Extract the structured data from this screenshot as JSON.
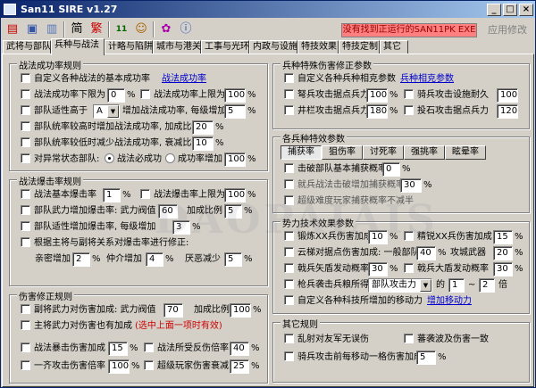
{
  "window": {
    "title": "San11 SIRE v1.27",
    "title_icon": "SIRE"
  },
  "toolbar": {
    "jian": "简",
    "fan": "繁",
    "number": "11"
  },
  "status": "没有找到正运行的SAN11PK EXE",
  "apply": "应用修改",
  "tabs": [
    "武将与部队",
    "兵种与战法",
    "计略与陷阱",
    "城市与港关",
    "工事与光环",
    "内政与设施",
    "特技效果",
    "特技定制",
    "其它"
  ],
  "g1": {
    "title": "战法成功率规则",
    "r1": "自定义各种战法的基本成功率",
    "r1link": "战法成功率",
    "r2a": "战法成功率下限为",
    "r2av": "0",
    "r2au": "%",
    "r2b": "战法成功率上限为",
    "r2bv": "100",
    "r2bu": "%",
    "r3a": "部队适性高于",
    "r3sel": "A",
    "r3b": "增加战法成功率, 每级增加",
    "r3v": "5",
    "r3u": "%",
    "r4": "部队统率较高时增加战法成功率, 加成比例",
    "r4v": "20",
    "r4u": "%",
    "r5": "部队统率较低时减少战法成功率, 衰减比例",
    "r5v": "10",
    "r5u": "%",
    "r6": "对异常状态部队:",
    "r6r1": "战法必成功",
    "r6r2": "成功率增加",
    "r6v": "100",
    "r6u": "%"
  },
  "g2": {
    "title": "战法爆击率规则",
    "r1a": "战法基本爆击率",
    "r1av": "1",
    "r1au": "%",
    "r1b": "战法爆击率上限为",
    "r1bv": "100",
    "r1bu": "%",
    "r2": "部队武力增加爆击率: 武力阀值",
    "r2v1": "60",
    "r2b": "加成比例",
    "r2v2": "5",
    "r2u": "%",
    "r3": "部队适性增加爆击率, 每级增加",
    "r3v": "3",
    "r3u": "%",
    "r4": "根据主将与副将关系对爆击率进行修正:",
    "r5a": "亲密增加",
    "r5av": "2",
    "r5b": "仲介增加",
    "r5bv": "4",
    "r5c": "厌恶减少",
    "r5cv": "5",
    "r5u": "%"
  },
  "g3": {
    "title": "伤害修正规则",
    "r1": "副将武力对伤害加成: 武力阀值",
    "r1v1": "70",
    "r1b": "加成比例",
    "r1v2": "100",
    "r1u": "%",
    "r2": "主将武力对伤害也有加成",
    "r2note": "(选中上面一项时有效)",
    "r3a": "战法暴击伤害加成",
    "r3av": "15",
    "r3u": "%",
    "r3b": "战法所受反伤倍率",
    "r3bv": "40",
    "r4a": "一齐攻击伤害倍率",
    "r4av": "100",
    "r4b": "超级玩家伤害衰减",
    "r4bv": "25"
  },
  "g4": {
    "title": "兵种特殊伤害修正参数",
    "r1": "自定义各种兵种相克参数",
    "r1link": "兵种相克参数",
    "r2a": "弩兵攻击据点兵力",
    "r2av": "100",
    "r2b": "骑兵攻击设施耐久",
    "r2bv": "100",
    "r3a": "井栏攻击据点兵力",
    "r3av": "180",
    "r3b": "投石攻击据点兵力",
    "r3bv": "120",
    "u": "%"
  },
  "g5": {
    "title": "各兵种特效参数",
    "subtabs": [
      "捕获率",
      "狙伤率",
      "讨死率",
      "强挑率",
      "眩晕率"
    ],
    "r1": "击破部队基本捕获概率",
    "r1v": "0",
    "r1u": "%",
    "r2": "就兵战法击破增加捕获概率",
    "r2v": "30",
    "r2u": "%",
    "r3": "超级难度玩家捕获概率不减半"
  },
  "g6": {
    "title": "势力技术效果参数",
    "r1a": "锻炼XX兵伤害加成",
    "r1av": "10",
    "r1b": "精锐XX兵伤害加成",
    "r1bv": "15",
    "r2a": "云梯对据点伤害加成: 一般部队",
    "r2av": "40",
    "r2b": "攻城武器",
    "r2bv": "20",
    "r3a": "戟兵矢盾发动概率",
    "r3av": "30",
    "r3b": "戟兵大盾发动概率",
    "r3bv": "30",
    "r4": "枪兵袭击兵粮所得",
    "r4sel": "部队攻击力",
    "r4of": "的",
    "r4v1": "1",
    "r4t": "~",
    "r4v2": "2",
    "r4u": "倍",
    "r5": "自定义各种科技所增加的移动力",
    "r5link": "增加移动力",
    "u": "%"
  },
  "g7": {
    "title": "其它规则",
    "r1a": "乱射对友军无误伤",
    "r1b": "蕃袭波及伤害一致",
    "r2": "骑兵攻击前每移动一格伤害加成",
    "r2v": "5",
    "r2u": "%"
  },
  "watermark": "DAOPAIAIS"
}
